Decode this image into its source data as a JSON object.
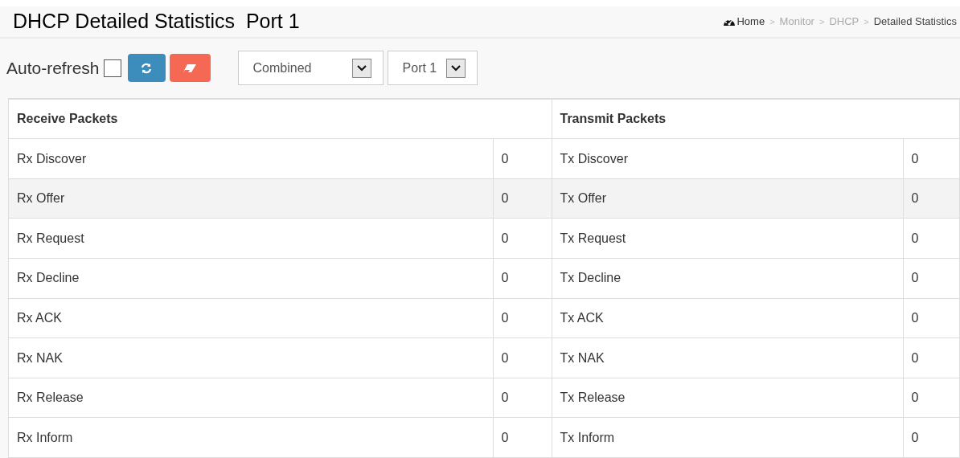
{
  "page_title": "DHCP Detailed Statistics  Port 1",
  "breadcrumb": [
    {
      "label": "Home",
      "kind": "home",
      "current": false
    },
    {
      "label": "Monitor",
      "kind": "link",
      "current": false
    },
    {
      "label": "DHCP",
      "kind": "link",
      "current": false
    },
    {
      "label": "Detailed Statistics",
      "kind": "link",
      "current": true
    }
  ],
  "separator": ">",
  "toolbar": {
    "auto_refresh_label": "Auto-refresh",
    "auto_refresh_checked": false,
    "selects": [
      {
        "value": "Combined"
      },
      {
        "value": "Port 1"
      }
    ]
  },
  "table": {
    "columns": [
      "Receive Packets",
      "Transmit Packets"
    ],
    "rows": [
      {
        "rx_label": "Rx Discover",
        "rx_value": "0",
        "tx_label": "Tx Discover",
        "tx_value": "0",
        "selected": false
      },
      {
        "rx_label": "Rx Offer",
        "rx_value": "0",
        "tx_label": "Tx Offer",
        "tx_value": "0",
        "selected": true
      },
      {
        "rx_label": "Rx Request",
        "rx_value": "0",
        "tx_label": "Tx Request",
        "tx_value": "0",
        "selected": false
      },
      {
        "rx_label": "Rx Decline",
        "rx_value": "0",
        "tx_label": "Tx Decline",
        "tx_value": "0",
        "selected": false
      },
      {
        "rx_label": "Rx ACK",
        "rx_value": "0",
        "tx_label": "Tx ACK",
        "tx_value": "0",
        "selected": false
      },
      {
        "rx_label": "Rx NAK",
        "rx_value": "0",
        "tx_label": "Tx NAK",
        "tx_value": "0",
        "selected": false
      },
      {
        "rx_label": "Rx Release",
        "rx_value": "0",
        "tx_label": "Tx Release",
        "tx_value": "0",
        "selected": false
      },
      {
        "rx_label": "Rx Inform",
        "rx_value": "0",
        "tx_label": "Tx Inform",
        "tx_value": "0",
        "selected": false
      }
    ]
  }
}
